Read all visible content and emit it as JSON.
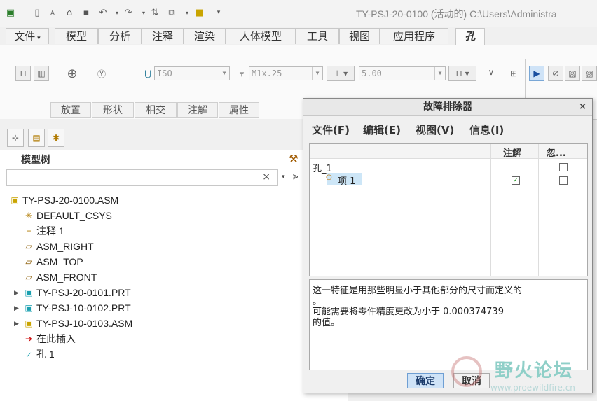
{
  "window": {
    "title": "TY-PSJ-20-0100 (活动的) C:\\Users\\Administra"
  },
  "ribbon_tabs": [
    {
      "label": "文件",
      "has_dropdown": true
    },
    {
      "label": "模型"
    },
    {
      "label": "分析"
    },
    {
      "label": "注释"
    },
    {
      "label": "渲染"
    },
    {
      "label": "人体模型"
    },
    {
      "label": "工具"
    },
    {
      "label": "视图"
    },
    {
      "label": "应用程序"
    },
    {
      "label": "孔",
      "active": true
    }
  ],
  "ribbon": {
    "standard_value": "ISO",
    "screw_size_value": "M1x.25",
    "depth_value": "5.00",
    "sub_tabs": [
      "放置",
      "形状",
      "相交",
      "注解",
      "属性"
    ]
  },
  "model_tree": {
    "label": "模型树",
    "search_placeholder": "",
    "clear_glyph": "×",
    "items": [
      {
        "label": "TY-PSJ-20-0100.ASM",
        "icon": "assembly-icon",
        "expandable": false,
        "indent": 0
      },
      {
        "label": "DEFAULT_CSYS",
        "icon": "csys-icon",
        "expandable": false,
        "indent": 1
      },
      {
        "label": "注释 1",
        "icon": "annotation-icon",
        "expandable": false,
        "indent": 1
      },
      {
        "label": "ASM_RIGHT",
        "icon": "datum-plane-icon",
        "expandable": false,
        "indent": 1
      },
      {
        "label": "ASM_TOP",
        "icon": "datum-plane-icon",
        "expandable": false,
        "indent": 1
      },
      {
        "label": "ASM_FRONT",
        "icon": "datum-plane-icon",
        "expandable": false,
        "indent": 1
      },
      {
        "label": "TY-PSJ-20-0101.PRT",
        "icon": "part-icon",
        "expandable": true,
        "indent": 1
      },
      {
        "label": "TY-PSJ-10-0102.PRT",
        "icon": "part-icon",
        "expandable": true,
        "indent": 1
      },
      {
        "label": "TY-PSJ-10-0103.ASM",
        "icon": "assembly-icon",
        "expandable": true,
        "indent": 1
      },
      {
        "label": "在此插入",
        "icon": "insert-here-arrow-icon",
        "expandable": false,
        "indent": 1
      },
      {
        "label": "孔 1",
        "icon": "hole-feature-icon",
        "expandable": false,
        "indent": 1
      }
    ]
  },
  "dialog": {
    "title": "故障排除器",
    "close_glyph": "×",
    "menu": [
      "文件(F)",
      "编辑(E)",
      "视图(V)",
      "信息(I)"
    ],
    "columns": [
      "注解",
      "忽..."
    ],
    "rows": [
      {
        "label": "孔_1",
        "note_checked": false,
        "ignore_checked": false
      },
      {
        "label": "项 1",
        "note_checked": true,
        "ignore_checked": false,
        "selected": true
      }
    ],
    "message_lines": [
      "这一特征是用那些明显小于其他部分的尺寸而定义的",
      "。",
      "可能需要将零件精度更改为小于 0.000374739",
      "的值。"
    ],
    "ok_label": "确定",
    "cancel_label": "取消"
  },
  "watermark": {
    "text": "野火论坛",
    "url": "www.proewildfire.cn"
  },
  "colors": {
    "dialog_ok_bg": "#cfe3f7",
    "selection_bg": "#cde6f7",
    "watermark": "#8fcfc8"
  }
}
